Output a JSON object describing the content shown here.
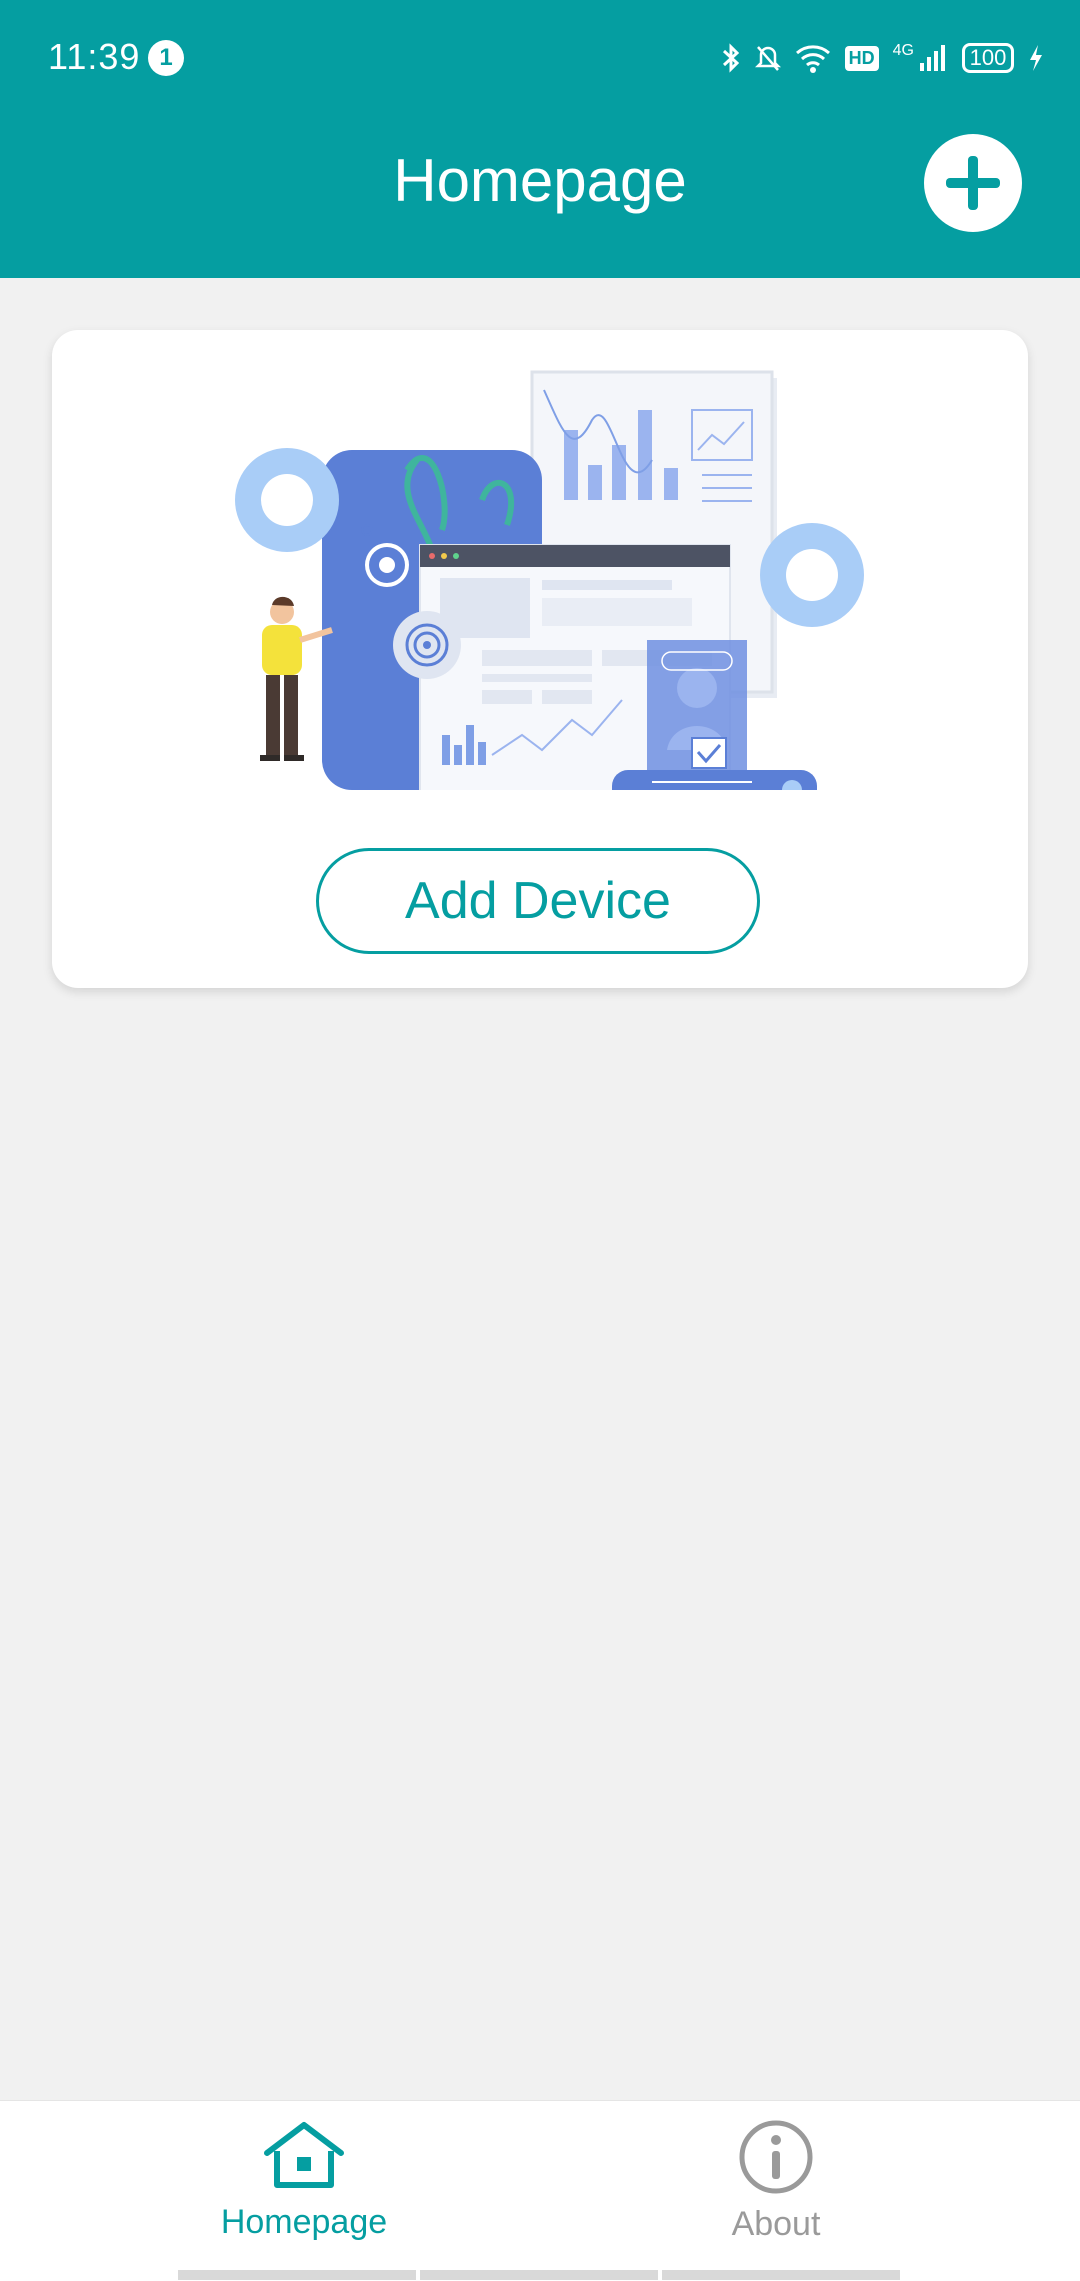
{
  "status_bar": {
    "time": "11:39",
    "notification_count": "1",
    "network": "4G",
    "hd_badge": "HD",
    "battery": "100"
  },
  "header": {
    "title": "Homepage",
    "add_icon": "plus-circle-icon"
  },
  "card": {
    "illustration": "device-dashboard-illustration",
    "add_device_label": "Add Device"
  },
  "bottom_nav": {
    "items": [
      {
        "label": "Homepage",
        "icon": "home-icon",
        "active": true
      },
      {
        "label": "About",
        "icon": "info-icon",
        "active": false
      }
    ]
  },
  "colors": {
    "primary": "#059ea1",
    "background": "#f1f1f1",
    "inactive": "#9a9a9a"
  }
}
